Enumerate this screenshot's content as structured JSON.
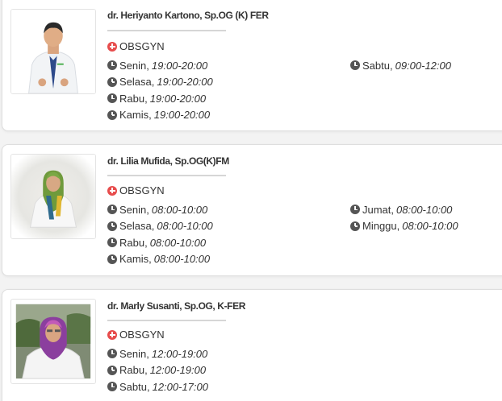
{
  "doctors": [
    {
      "name": "dr. Heriyanto Kartono, Sp.OG (K) FER",
      "specialty": "OBSGYN",
      "schedule_left": [
        {
          "day": "Senin,",
          "time": "19:00-20:00"
        },
        {
          "day": "Selasa,",
          "time": "19:00-20:00"
        },
        {
          "day": "Rabu,",
          "time": "19:00-20:00"
        },
        {
          "day": "Kamis,",
          "time": "19:00-20:00"
        }
      ],
      "schedule_right": [
        {
          "day": "Sabtu,",
          "time": "09:00-12:00"
        }
      ]
    },
    {
      "name": "dr. Lilia Mufida, Sp.OG(K)FM",
      "specialty": "OBSGYN",
      "schedule_left": [
        {
          "day": "Senin,",
          "time": "08:00-10:00"
        },
        {
          "day": "Selasa,",
          "time": "08:00-10:00"
        },
        {
          "day": "Rabu,",
          "time": "08:00-10:00"
        },
        {
          "day": "Kamis,",
          "time": "08:00-10:00"
        }
      ],
      "schedule_right": [
        {
          "day": "Jumat,",
          "time": "08:00-10:00"
        },
        {
          "day": "Minggu,",
          "time": "08:00-10:00"
        }
      ]
    },
    {
      "name": "dr. Marly Susanti, Sp.OG, K-FER",
      "specialty": "OBSGYN",
      "schedule_left": [
        {
          "day": "Senin,",
          "time": "12:00-19:00"
        },
        {
          "day": "Rabu,",
          "time": "12:00-19:00"
        },
        {
          "day": "Sabtu,",
          "time": "12:00-17:00"
        }
      ],
      "schedule_right": []
    }
  ],
  "icons": {
    "specialty": "plus-circle-icon",
    "schedule": "clock-icon"
  },
  "colors": {
    "specialty_icon": "#e74c4c",
    "clock_icon": "#555555",
    "divider": "#d6d6d6"
  }
}
